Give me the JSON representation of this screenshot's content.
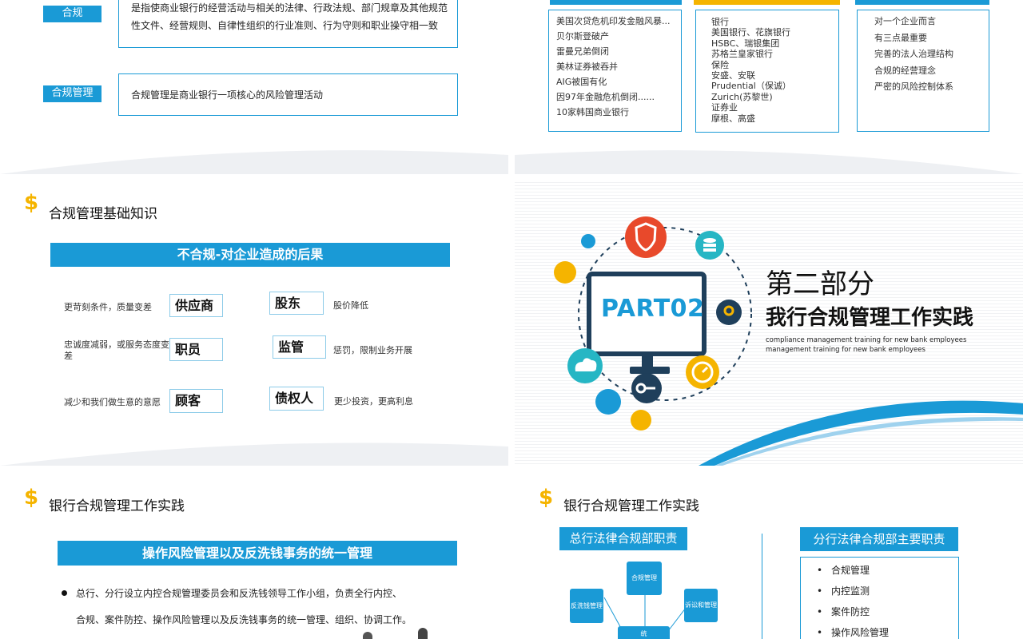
{
  "panel1": {
    "tags": {
      "compliance": "合规",
      "compliance_mgmt": "合规管理"
    },
    "def_line1": "是指使商业银行的经营活动与相关的法律、行政法规、部门规章及其他规范",
    "def_line2": "性文件、经营规则、自律性组织的行业准则、行为守则和职业操守相一致",
    "mgmt_text": "合规管理是商业银行一项核心的风险管理活动"
  },
  "panel2": {
    "col1": [
      "美国次贷危机印发金融风暴...",
      "贝尔斯登破产",
      "雷曼兄弟倒闭",
      "美林证券被吞并",
      "AIG被国有化",
      "因97年金融危机倒闭......",
      "10家韩国商业银行"
    ],
    "col2": [
      "银行",
      "美国银行、花旗银行",
      "HSBC、瑞银集团",
      "苏格兰皇家银行",
      "保险",
      "安盛、安联",
      "Prudential（保诚）",
      "Zurich(苏黎世)",
      "证券业",
      "摩根、高盛"
    ],
    "col3": [
      "对一个企业而言",
      "有三点最重要",
      "完善的法人治理结构",
      "合规的经营理念",
      "严密的风险控制体系"
    ]
  },
  "panel3": {
    "title": "合规管理基础知识",
    "banner": "不合规-对企业造成的后果",
    "rows": [
      {
        "left": "更苛刻条件，质量变差",
        "box1": "供应商",
        "box2": "股东",
        "right": "股价降低"
      },
      {
        "left": "忠诚度减弱，或服务态度变差",
        "box1": "职员",
        "box2": "监管",
        "right": "惩罚，限制业务开展"
      },
      {
        "left": "减少和我们做生意的意愿",
        "box1": "顾客",
        "box2": "债权人",
        "right": "更少投资，更高利息"
      }
    ]
  },
  "panel4": {
    "part_label": "PART02",
    "heading1": "第二部分",
    "heading2": "我行合规管理工作实践",
    "sub1": "compliance management training for new bank employees",
    "sub2": "management training for new bank employees"
  },
  "panel5": {
    "title": "银行合规管理工作实践",
    "banner": "操作风险管理以及反洗钱事务的统一管理",
    "bullet_line1": "总行、分行设立内控合规管理委员会和反洗钱领导工作小组，负责全行内控、",
    "bullet_line2": "合规、案件防控、操作风险管理以及反洗钱事务的统一管理、组织、协调工作。"
  },
  "panel6": {
    "title": "银行合规管理工作实践",
    "head_office": "总行法律合规部职责",
    "branch": "分行法律合规部主要职责",
    "nodes": {
      "top": "合规管理",
      "left": "反洗钱管理",
      "right": "诉讼和管理",
      "bottom": "统"
    },
    "branch_items": [
      "合规管理",
      "内控监测",
      "案件防控",
      "操作风险管理"
    ]
  },
  "colors": {
    "accent": "#1a9ad6",
    "gold": "#f5b400",
    "navy": "#1f3f5b",
    "red": "#e8492b"
  }
}
